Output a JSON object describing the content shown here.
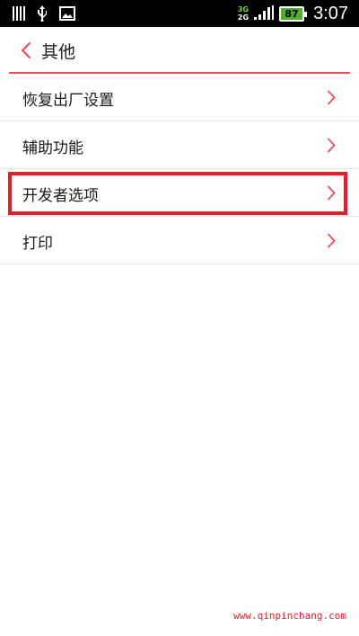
{
  "status_bar": {
    "network_top": "3G",
    "network_bottom": "2G",
    "battery": "87",
    "time": "3:07"
  },
  "header": {
    "title": "其他"
  },
  "menu": {
    "items": [
      {
        "label": "恢复出厂设置"
      },
      {
        "label": "辅助功能"
      },
      {
        "label": "开发者选项"
      },
      {
        "label": "打印"
      }
    ]
  },
  "watermark": "www.qinpinchang.com",
  "colors": {
    "accent": "#e8505b",
    "highlight": "#e01f2b",
    "battery": "#4fae2a"
  }
}
